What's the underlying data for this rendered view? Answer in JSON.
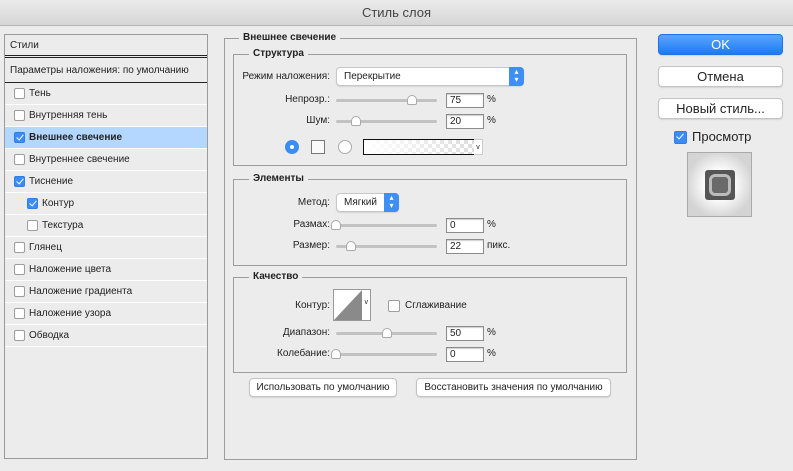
{
  "window": {
    "title": "Стиль слоя"
  },
  "sidebar": {
    "header": "Стили",
    "blending_options": "Параметры наложения: по умолчанию",
    "items": [
      {
        "label": "Тень",
        "checked": false
      },
      {
        "label": "Внутренняя тень",
        "checked": false
      },
      {
        "label": "Внешнее свечение",
        "checked": true,
        "selected": true
      },
      {
        "label": "Внутреннее свечение",
        "checked": false
      },
      {
        "label": "Тиснение",
        "checked": true
      },
      {
        "label": "Контур",
        "checked": true,
        "indent": true
      },
      {
        "label": "Текстура",
        "checked": false,
        "indent": true
      },
      {
        "label": "Глянец",
        "checked": false
      },
      {
        "label": "Наложение цвета",
        "checked": false
      },
      {
        "label": "Наложение градиента",
        "checked": false
      },
      {
        "label": "Наложение узора",
        "checked": false
      },
      {
        "label": "Обводка",
        "checked": false
      }
    ]
  },
  "main": {
    "title": "Внешнее свечение",
    "structure": {
      "title": "Структура",
      "blend_mode_label": "Режим наложения:",
      "blend_mode_value": "Перекрытие",
      "opacity_label": "Непрозр.:",
      "opacity_value": "75",
      "opacity_unit": "%",
      "noise_label": "Шум:",
      "noise_value": "20",
      "noise_unit": "%",
      "fill_type": "color"
    },
    "elements": {
      "title": "Элементы",
      "technique_label": "Метод:",
      "technique_value": "Мягкий",
      "spread_label": "Размах:",
      "spread_value": "0",
      "spread_unit": "%",
      "size_label": "Размер:",
      "size_value": "22",
      "size_unit": "пикс."
    },
    "quality": {
      "title": "Качество",
      "contour_label": "Контур:",
      "antialias_label": "Сглаживание",
      "antialias_checked": false,
      "range_label": "Диапазон:",
      "range_value": "50",
      "range_unit": "%",
      "jitter_label": "Колебание:",
      "jitter_value": "0",
      "jitter_unit": "%"
    },
    "make_default": "Использовать по умолчанию",
    "reset_default": "Восстановить значения по умолчанию"
  },
  "actions": {
    "ok": "OK",
    "cancel": "Отмена",
    "new_style": "Новый стиль...",
    "preview_label": "Просмотр",
    "preview_checked": true,
    "accent": "#1b7bf4"
  }
}
